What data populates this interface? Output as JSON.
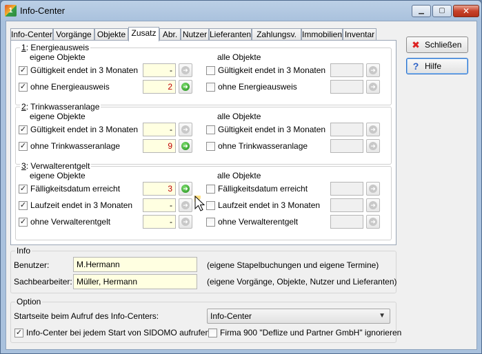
{
  "window": {
    "title": "Info-Center",
    "icon_text": "1"
  },
  "tabs": [
    "Info-Center",
    "Vorgänge",
    "Objekte",
    "Zusatz",
    "Abr.",
    "Nutzer",
    "Lieferanten",
    "Zahlungsv.",
    "Immobilien",
    "Inventar"
  ],
  "active_tab": "Zusatz",
  "side_buttons": {
    "close_label": "Schließen",
    "help_label": "Hilfe"
  },
  "columns": {
    "own": "eigene Objekte",
    "all": "alle Objekte"
  },
  "groups": [
    {
      "num": "1",
      "title": ": Energieausweis",
      "rows": [
        {
          "own_label": "Gültigkeit endet in 3 Monaten",
          "own_checked": true,
          "own_value": "-",
          "own_active": false,
          "all_label": "Gültigkeit endet in 3 Monaten",
          "all_checked": false
        },
        {
          "own_label": "ohne Energieausweis",
          "own_checked": true,
          "own_value": "2",
          "own_active": true,
          "all_label": "ohne Energieausweis",
          "all_checked": false
        }
      ]
    },
    {
      "num": "2",
      "title": ": Trinkwasseranlage",
      "rows": [
        {
          "own_label": "Gültigkeit endet in 3 Monaten",
          "own_checked": true,
          "own_value": "-",
          "own_active": false,
          "all_label": "Gültigkeit endet in 3 Monaten",
          "all_checked": false
        },
        {
          "own_label": "ohne Trinkwasseranlage",
          "own_checked": true,
          "own_value": "9",
          "own_active": true,
          "all_label": "ohne Trinkwasseranlage",
          "all_checked": false
        }
      ]
    },
    {
      "num": "3",
      "title": ": Verwalterentgelt",
      "rows": [
        {
          "own_label": "Fälligkeitsdatum erreicht",
          "own_checked": true,
          "own_value": "3",
          "own_active": true,
          "all_label": "Fälligkeitsdatum erreicht",
          "all_checked": false
        },
        {
          "own_label": "Laufzeit endet in 3 Monaten",
          "own_checked": true,
          "own_value": "-",
          "own_active": false,
          "all_label": "Laufzeit endet in 3 Monaten",
          "all_checked": false
        },
        {
          "own_label": "ohne Verwalterentgelt",
          "own_checked": true,
          "own_value": "-",
          "own_active": false,
          "all_label": "ohne Verwalterentgelt",
          "all_checked": false
        }
      ]
    }
  ],
  "info": {
    "title": "Info",
    "user_label": "Benutzer:",
    "user_value": "M.Hermann",
    "user_hint": "(eigene Stapelbuchungen und eigene Termine)",
    "clerk_label": "Sachbearbeiter:",
    "clerk_value": "Müller, Hermann",
    "clerk_hint": "(eigene Vorgänge, Objekte, Nutzer und Lieferanten)"
  },
  "option": {
    "title": "Option",
    "startpage_label": "Startseite beim Aufruf des Info-Centers:",
    "startpage_value": "Info-Center",
    "autostart_label": "Info-Center bei jedem Start von SIDOMO aufrufen",
    "autostart_checked": true,
    "ignore_label": "Firma 900 \"Deflize und Partner GmbH\" ignorieren",
    "ignore_checked": false
  }
}
